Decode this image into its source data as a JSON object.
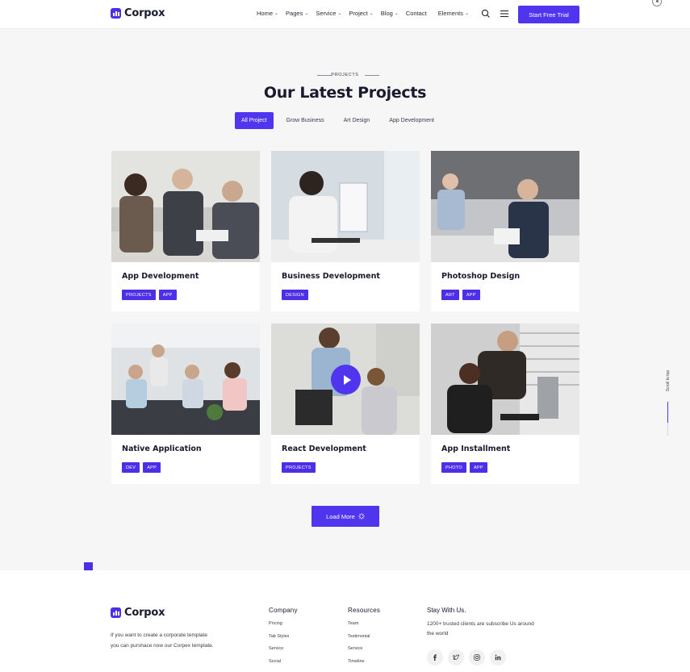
{
  "brand": {
    "name": "Corpox",
    "accent": "#5035ee"
  },
  "nav": {
    "items": [
      {
        "label": "Home",
        "has_dropdown": true
      },
      {
        "label": "Pages",
        "has_dropdown": true
      },
      {
        "label": "Service",
        "has_dropdown": true
      },
      {
        "label": "Project",
        "has_dropdown": true
      },
      {
        "label": "Blog",
        "has_dropdown": true
      },
      {
        "label": "Contact",
        "has_dropdown": false
      },
      {
        "label": "Elements",
        "has_dropdown": true
      }
    ],
    "icons": [
      "search-icon",
      "menu-icon"
    ],
    "cta_label": "Start Free Trial"
  },
  "section": {
    "eyebrow": "PROJECTS",
    "title": "Our Latest Projects",
    "filters": [
      "All Project",
      "Grow Business",
      "Art Design",
      "App Development"
    ],
    "active_filter": "All Project"
  },
  "projects": [
    {
      "title": "App Development",
      "tags": [
        "PROJECTS",
        "APP"
      ]
    },
    {
      "title": "Business Development",
      "tags": [
        "DESIGN"
      ]
    },
    {
      "title": "Photoshop Design",
      "tags": [
        "ART",
        "APP"
      ]
    },
    {
      "title": "Native Application",
      "tags": [
        "DEV",
        "APP"
      ]
    },
    {
      "title": "React Development",
      "tags": [
        "PROJECTS"
      ],
      "has_play": true
    },
    {
      "title": "App Installment",
      "tags": [
        "PHOTO",
        "APP"
      ]
    }
  ],
  "load_more_label": "Load More",
  "scroll_top_label": "Scroll to top",
  "footer": {
    "brand": "Corpox",
    "description": "If you want to create a corporate template you can purshace now our Corpex template.",
    "columns": [
      {
        "heading": "Company",
        "links": [
          "Pricing",
          "Tab Styles",
          "Service",
          "Social"
        ]
      },
      {
        "heading": "Resources",
        "links": [
          "Team",
          "Testimonial",
          "Service",
          "Timeline"
        ]
      }
    ],
    "stay": {
      "heading": "Stay With Us.",
      "text": "1200+ trusted clients are subscribe Us around the world"
    },
    "socials": [
      "facebook-icon",
      "twitter-icon",
      "instagram-icon",
      "linkedin-icon"
    ]
  }
}
